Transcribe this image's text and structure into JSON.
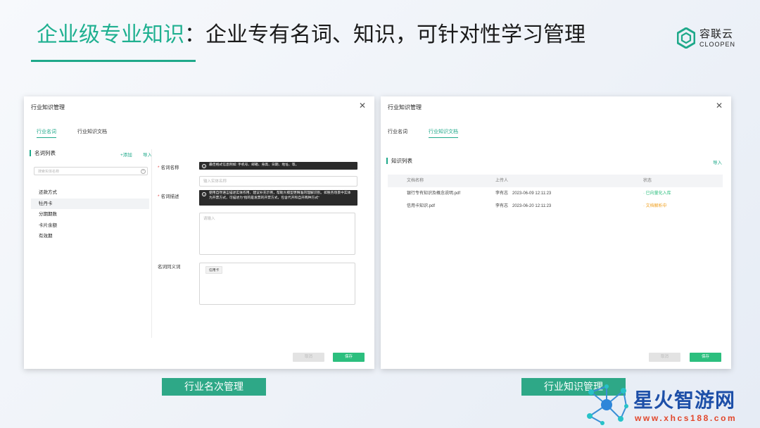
{
  "slide": {
    "title_highlight": "企业级专业知识",
    "title_rest": "：企业专有名词、知识，可针对性学习管理"
  },
  "logo": {
    "cn": "容联云",
    "en": "CLOOPEN",
    "icon": "hexagon-logo-icon"
  },
  "left_panel": {
    "title": "行业知识管理",
    "tabs": [
      {
        "label": "行业名词",
        "active": true
      },
      {
        "label": "行业知识文档",
        "active": false
      }
    ],
    "list_header": "名词列表",
    "add_link": "+添加",
    "import_link": "导入",
    "search_placeholder": "搜索实体名称",
    "terms": [
      "还款方式",
      "牡丹卡",
      "分期期数",
      "卡片余额",
      "有效期"
    ],
    "selected_term_index": 1,
    "form": {
      "name_label": "名词名称",
      "name_tip": "最佳格式信息例如: 手机号、邮箱、身高、日期、地址、等。",
      "name_placeholder": "输入实体名称",
      "desc_label": "名词描述",
      "desc_tip": "使用自然语言描述实体作用、建议补充示例，帮助大模型更精准的理解识别。如税务场景中实体为开票方式，可描述为“指的是发票的开票方式，包含代开和自开两种方式”",
      "desc_placeholder": "请输入",
      "synonym_label": "名词同义词",
      "synonym_chip": "信用卡"
    },
    "cancel_label": "取消",
    "save_label": "保存"
  },
  "right_panel": {
    "title": "行业知识管理",
    "tabs": [
      {
        "label": "行业名词",
        "active": false
      },
      {
        "label": "行业知识文档",
        "active": true
      }
    ],
    "list_header": "知识列表",
    "import_link": "导入",
    "columns": [
      "文档名称",
      "上传人",
      "状态"
    ],
    "rows": [
      {
        "name": "银行专有知识及概念说明.pdf",
        "uploader": "李有志",
        "time": "2023-06-09 12:11:23",
        "status": "· 已向量化入库",
        "status_color": "#2cbf7e"
      },
      {
        "name": "信用卡知识.pdf",
        "uploader": "李有志",
        "time": "2023-06-20 12:11:23",
        "status": "· 文档解析中",
        "status_color": "#f0a020"
      }
    ],
    "cancel_label": "取消",
    "save_label": "保存"
  },
  "captions": {
    "left": "行业名次管理",
    "right": "行业知识管理"
  },
  "watermark": {
    "cn": "星火智游网",
    "en": "www.xhcs188.com"
  },
  "colors": {
    "accent": "#1fa98a",
    "save_button": "#2cbf7e",
    "caption_bg": "#2ea887",
    "watermark_blue": "#1d4fa8",
    "watermark_red": "#e2462a"
  }
}
